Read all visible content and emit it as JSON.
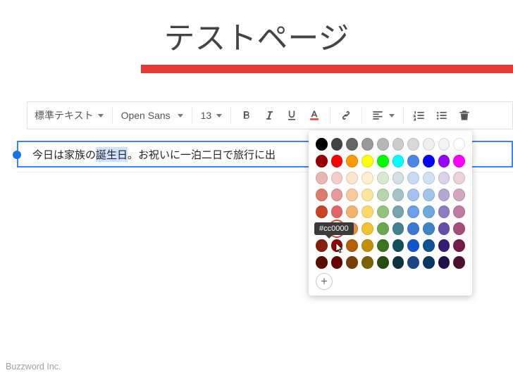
{
  "page": {
    "title": "テストページ"
  },
  "toolbar": {
    "style_label": "標準テキスト",
    "font_label": "Open Sans",
    "size_label": "13"
  },
  "editor": {
    "text_before": "今日は家族の",
    "text_selected": "誕生日",
    "text_after": "。お祝いに一泊二日で旅行に出"
  },
  "palette": {
    "tooltip": "#cc0000",
    "selected_hex": "#cc0000",
    "rows": [
      [
        "#000000",
        "#434343",
        "#666666",
        "#999999",
        "#b7b7b7",
        "#cccccc",
        "#d9d9d9",
        "#efefef",
        "#f3f3f3",
        "#ffffff"
      ],
      [
        "#980000",
        "#ff0000",
        "#ff9900",
        "#ffff00",
        "#00ff00",
        "#00ffff",
        "#4a86e8",
        "#0000ff",
        "#9900ff",
        "#ff00ff"
      ],
      [
        "#e6b8af",
        "#f4cccc",
        "#fce5cd",
        "#fff2cc",
        "#d9ead3",
        "#d0e0e3",
        "#c9daf8",
        "#cfe2f3",
        "#d9d2e9",
        "#ead1dc"
      ],
      [
        "#dd7e6b",
        "#ea9999",
        "#f9cb9c",
        "#ffe599",
        "#b6d7a8",
        "#a2c4c9",
        "#a4c2f4",
        "#9fc5e8",
        "#b4a7d6",
        "#d5a6bd"
      ],
      [
        "#cc4125",
        "#e06666",
        "#f6b26b",
        "#ffd966",
        "#93c47d",
        "#76a5af",
        "#6d9eeb",
        "#6fa8dc",
        "#8e7cc3",
        "#c27ba0"
      ],
      [
        "#a61c00",
        "#cc0000",
        "#e69138",
        "#f1c232",
        "#6aa84f",
        "#45818e",
        "#3c78d8",
        "#3d85c6",
        "#674ea7",
        "#a64d79"
      ],
      [
        "#85200c",
        "#990000",
        "#b45f06",
        "#bf9000",
        "#38761d",
        "#134f5c",
        "#1155cc",
        "#0b5394",
        "#351c75",
        "#741b47"
      ],
      [
        "#5b0f00",
        "#660000",
        "#783f04",
        "#7f6000",
        "#274e13",
        "#0c343d",
        "#1c4587",
        "#073763",
        "#20124d",
        "#4c1130"
      ]
    ]
  },
  "footer": {
    "text": "Buzzword Inc."
  }
}
